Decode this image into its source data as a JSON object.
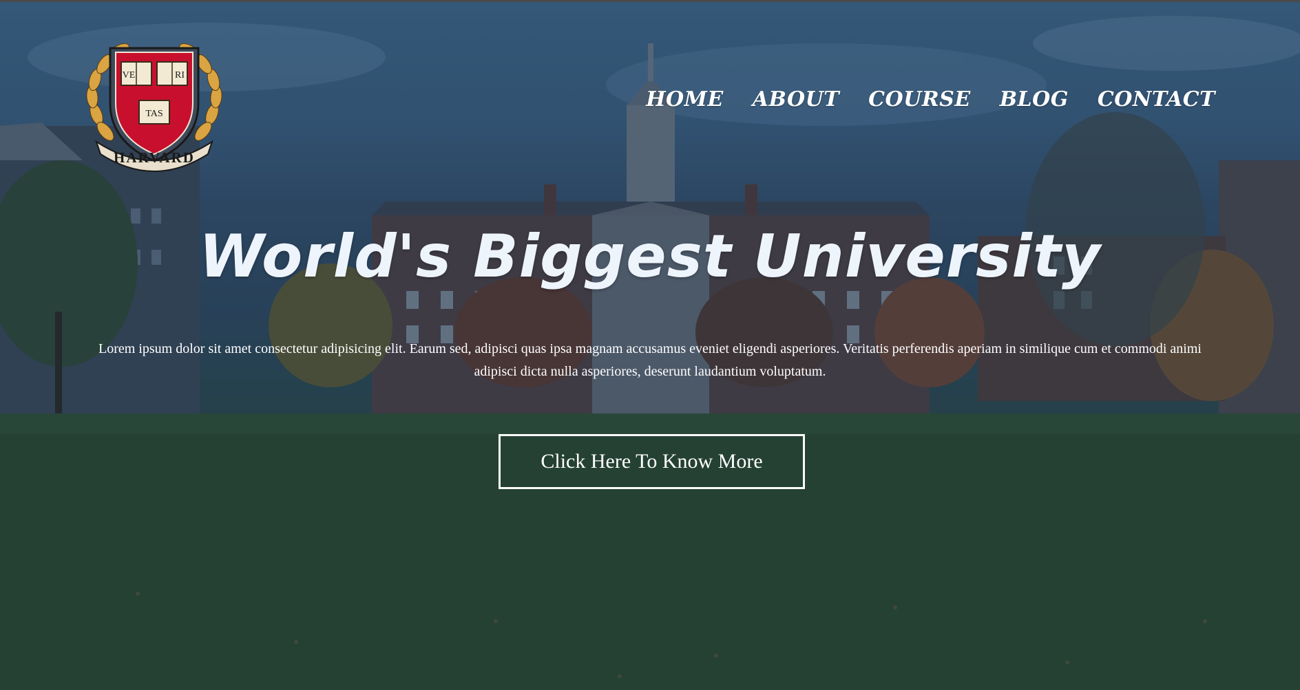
{
  "brand": {
    "logo_alt": "Harvard",
    "shield_words": [
      "VE",
      "RI",
      "TAS"
    ],
    "banner_text": "HARVARD",
    "colors": {
      "shield": "#c8102e",
      "laurel": "#d9a441",
      "book": "#f3ead4"
    }
  },
  "nav": {
    "items": [
      {
        "label": "HOME"
      },
      {
        "label": "ABOUT"
      },
      {
        "label": "COURSE"
      },
      {
        "label": "BLOG"
      },
      {
        "label": "CONTACT"
      }
    ]
  },
  "hero": {
    "title": "World's Biggest University",
    "description": "Lorem ipsum dolor sit amet consectetur adipisicing elit. Earum sed, adipisci quas ipsa magnam accusamus eveniet eligendi asperiores. Veritatis perferendis aperiam in similique cum et commodi animi adipisci dicta nulla asperiores, deserunt laudantium voluptatum.",
    "cta_label": "Click Here To Know More"
  },
  "theme": {
    "overlay": "#142846",
    "text": "#ffffff",
    "title_color": "#eef4fb"
  }
}
